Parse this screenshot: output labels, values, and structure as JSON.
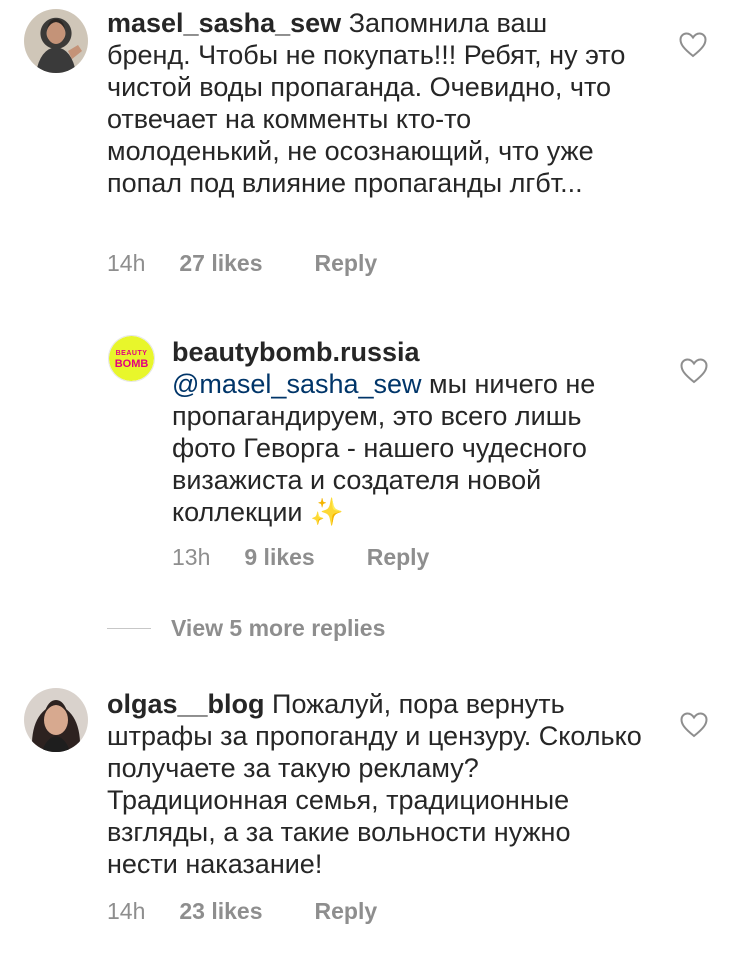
{
  "comments": [
    {
      "username": "masel_sasha_sew",
      "text": "Запомнила ваш бренд. Чтобы не покупать!!! Ребят, ну это чистой воды пропаганда. Очевидно, что отвечает на комменты кто-то молоденький, не осознающий, что уже попал под влияние пропаганды лгбт...",
      "time": "14h",
      "likes": "27 likes",
      "reply": "Reply",
      "avatar_icon": "user-photo-avatar"
    },
    {
      "username": "beautybomb.russia",
      "mention": "@masel_sasha_sew",
      "text": "мы ничего не пропагандируем, это всего лишь фото Геворга - нашего чудесного визажиста и создателя новой коллекции",
      "emoji": "✨",
      "time": "13h",
      "likes": "9 likes",
      "reply": "Reply",
      "avatar_lines": [
        "BEAUTY",
        "BOMB"
      ],
      "avatar_color": "#e8f62b",
      "avatar_text_color": "#e4007f"
    },
    {
      "username": "olgas__blog",
      "text": "Пожалуй, пора вернуть штрафы за пропоганду и цензуру. Сколько получаете за такую рекламу? Традиционная семья, традиционные взгляды, а за такие вольности нужно нести наказание!",
      "time": "14h",
      "likes": "23 likes",
      "reply": "Reply",
      "avatar_icon": "user-photo-avatar"
    }
  ],
  "view_more_replies": "View 5 more replies",
  "icons": {
    "like": "heart-outline-icon"
  },
  "colors": {
    "text": "#262626",
    "meta": "#8e8e8e",
    "mention": "#003569"
  }
}
